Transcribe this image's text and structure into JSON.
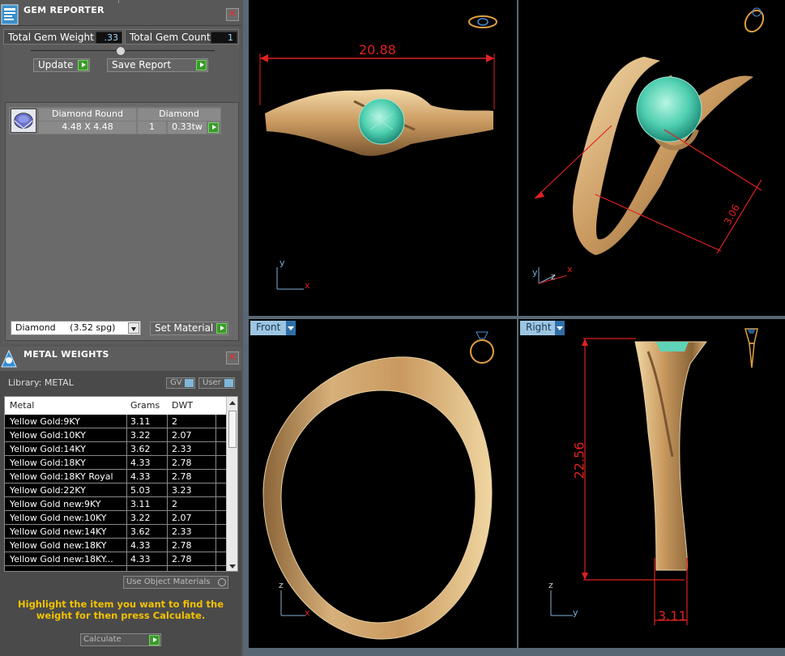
{
  "gem_reporter": {
    "title": "GEM REPORTER",
    "total_gem_weight_label": "Total Gem Weight",
    "total_gem_weight_value": ".33",
    "total_gem_count_label": "Total Gem Count",
    "total_gem_count_value": "1",
    "update_label": "Update",
    "save_report_label": "Save Report",
    "gem_row": {
      "shape": "Diamond Round",
      "material": "Diamond",
      "size": "4.48 X 4.48",
      "count": "1",
      "weight": "0.33tw"
    },
    "material_select": "Diamond     (3.52 spg)",
    "set_material_label": "Set Material"
  },
  "metal_weights": {
    "title": "METAL WEIGHTS",
    "library_label": "Library: METAL",
    "gv_label": "GV",
    "user_label": "User",
    "columns": [
      "Metal",
      "Grams",
      "DWT"
    ],
    "rows": [
      {
        "metal": "Yellow Gold:9KY",
        "grams": "3.11",
        "dwt": "2"
      },
      {
        "metal": "Yellow Gold:10KY",
        "grams": "3.22",
        "dwt": "2.07"
      },
      {
        "metal": "Yellow Gold:14KY",
        "grams": "3.62",
        "dwt": "2.33"
      },
      {
        "metal": "Yellow Gold:18KY",
        "grams": "4.33",
        "dwt": "2.78"
      },
      {
        "metal": "Yellow Gold:18KY Royal",
        "grams": "4.33",
        "dwt": "2.78"
      },
      {
        "metal": "Yellow Gold:22KY",
        "grams": "5.03",
        "dwt": "3.23"
      },
      {
        "metal": "Yellow Gold new:9KY",
        "grams": "3.11",
        "dwt": "2"
      },
      {
        "metal": "Yellow Gold new:10KY",
        "grams": "3.22",
        "dwt": "2.07"
      },
      {
        "metal": "Yellow Gold new:14KY",
        "grams": "3.62",
        "dwt": "2.33"
      },
      {
        "metal": "Yellow Gold new:18KY",
        "grams": "4.33",
        "dwt": "2.78"
      },
      {
        "metal": "Yellow Gold new:18KY...",
        "grams": "4.33",
        "dwt": "2.78"
      }
    ],
    "use_object_materials_label": "Use Object Materials",
    "hint": "Highlight the item you want to find the weight for then press Calculate.",
    "calculate_label": "Calculate"
  },
  "viewports": {
    "top_left": {
      "dimension": "20.88",
      "axes": [
        "y",
        "x"
      ]
    },
    "top_right": {
      "dimension": "3.06",
      "axes": [
        "y",
        "z",
        "x"
      ]
    },
    "front": {
      "label": "Front",
      "axes": [
        "z",
        "x"
      ]
    },
    "right": {
      "label": "Right",
      "height_dimension": "22.56",
      "width_dimension": "3.11",
      "axes": [
        "z",
        "y"
      ]
    }
  },
  "colors": {
    "panel_bg": "#575757",
    "accent_green": "#3a9a2a",
    "hint_yellow": "#f2c200",
    "dimension_red": "#e02020",
    "viewport_tab": "#9cc5e2",
    "gold": "#c9a06a",
    "gem": "#5fd3b8"
  },
  "icons": [
    "gem-reporter-icon",
    "metal-weights-icon",
    "close-icon",
    "play-arrow-icon",
    "dropdown-arrow-icon",
    "ring-preview-icon"
  ]
}
